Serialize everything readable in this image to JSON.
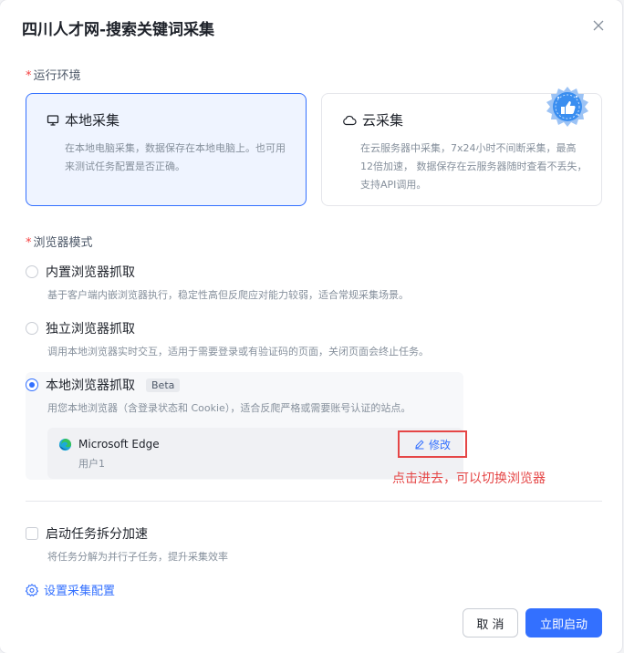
{
  "dialog": {
    "title": "四川人才网-搜索关键词采集"
  },
  "env": {
    "label": "运行环境",
    "local": {
      "title": "本地采集",
      "desc": "在本地电脑采集，数据保存在本地电脑上。也可用来测试任务配置是否正确。"
    },
    "cloud": {
      "title": "云采集",
      "desc": "在云服务器中采集，7x24小时不间断采集，最高12倍加速， 数据保存在云服务器随时查看不丢失，支持API调用。"
    }
  },
  "browser_mode": {
    "label": "浏览器模式",
    "options": [
      {
        "label": "内置浏览器抓取",
        "desc": "基于客户端内嵌浏览器执行，稳定性高但反爬应对能力较弱，适合常规采集场景。"
      },
      {
        "label": "独立浏览器抓取",
        "desc": "调用本地浏览器实时交互，适用于需要登录或有验证码的页面，关闭页面会终止任务。"
      },
      {
        "label": "本地浏览器抓取",
        "badge": "Beta",
        "desc": "用您本地浏览器（含登录状态和 Cookie），适合反爬严格或需要账号认证的站点。"
      }
    ],
    "selected_browser": {
      "name": "Microsoft Edge",
      "user": "用户1",
      "edit_label": "修改"
    },
    "annotation": "点击进去，可以切换浏览器"
  },
  "split": {
    "label": "启动任务拆分加速",
    "desc": "将任务分解为并行子任务，提升采集效率"
  },
  "config_link": "设置采集配置",
  "footer": {
    "cancel": "取 消",
    "start": "立即启动"
  },
  "colors": {
    "primary": "#3370ff",
    "annotation": "#e54646",
    "required": "#f53f3f"
  }
}
